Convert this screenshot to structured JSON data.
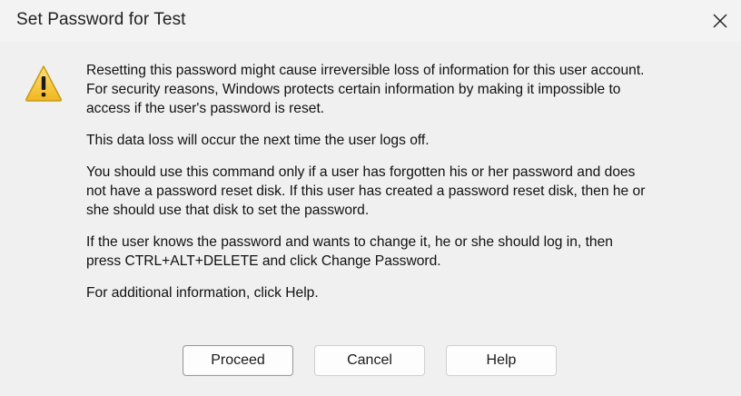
{
  "window": {
    "title": "Set Password for Test"
  },
  "icons": {
    "warning": "warning-triangle-icon",
    "close": "close-icon"
  },
  "message": {
    "p1": "Resetting this password might cause irreversible loss of information for this user account.\nFor security reasons, Windows protects certain information by making it impossible to\naccess if the user's password is reset.",
    "p2": "This data loss will occur the next time the user logs off.",
    "p3": "You should use this command only if a user has forgotten his or her password and does\nnot have a password reset disk. If this user has created a password reset disk, then he or\nshe should use that disk to set the password.",
    "p4": "If the user knows the password and wants to change it, he or she should log in, then\npress CTRL+ALT+DELETE and click Change Password.",
    "p5": "For additional information, click Help."
  },
  "buttons": {
    "proceed": "Proceed",
    "cancel": "Cancel",
    "help": "Help"
  },
  "colors": {
    "warning_fill": "#f7c948",
    "warning_border": "#c79a12",
    "warning_mark": "#1a1a1a"
  }
}
